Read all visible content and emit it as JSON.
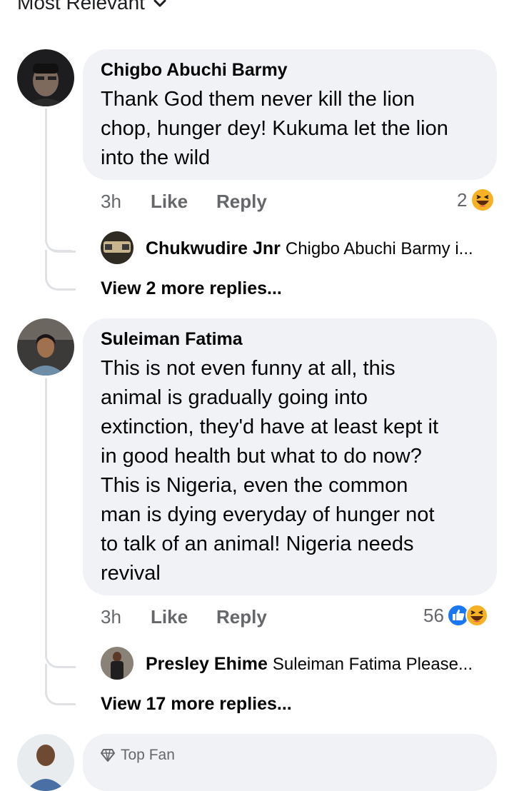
{
  "sort": {
    "label": "Most Relevant"
  },
  "comments": [
    {
      "author": "Chigbo Abuchi Barmy",
      "lines": [
        "Thank God them never kill the lion",
        "chop, hunger dey! Kukuma let the lion",
        "into the wild"
      ],
      "time": "3h",
      "like_label": "Like",
      "reply_label": "Reply",
      "reaction_count": "2",
      "reactions": [
        "haha-emoji"
      ],
      "reply_preview": {
        "author": "Chukwudire Jnr",
        "text": "Chigbo Abuchi Barmy i..."
      },
      "more_replies": "View 2 more replies..."
    },
    {
      "author": "Suleiman Fatima",
      "lines": [
        "This is not even funny at all, this",
        "animal is gradually going into",
        "extinction, they'd have at least kept it",
        "in good health but what to do now?",
        "This is Nigeria, even the common",
        "man is dying everyday of hunger not",
        "to talk of an animal! Nigeria needs",
        "revival"
      ],
      "time": "3h",
      "like_label": "Like",
      "reply_label": "Reply",
      "reaction_count": "56",
      "reactions": [
        "like-reaction",
        "haha-emoji"
      ],
      "reply_preview": {
        "author": "Presley Ehime",
        "text": "Suleiman Fatima  Please..."
      },
      "more_replies": "View 17 more replies..."
    },
    {
      "badge": "Top Fan",
      "badge_icon": "diamond-icon"
    }
  ],
  "colors": {
    "bubble": "#f0f2f5",
    "like_blue": "#1877f2",
    "haha_yellow": "#f7b125",
    "meta_gray": "#65676b"
  }
}
